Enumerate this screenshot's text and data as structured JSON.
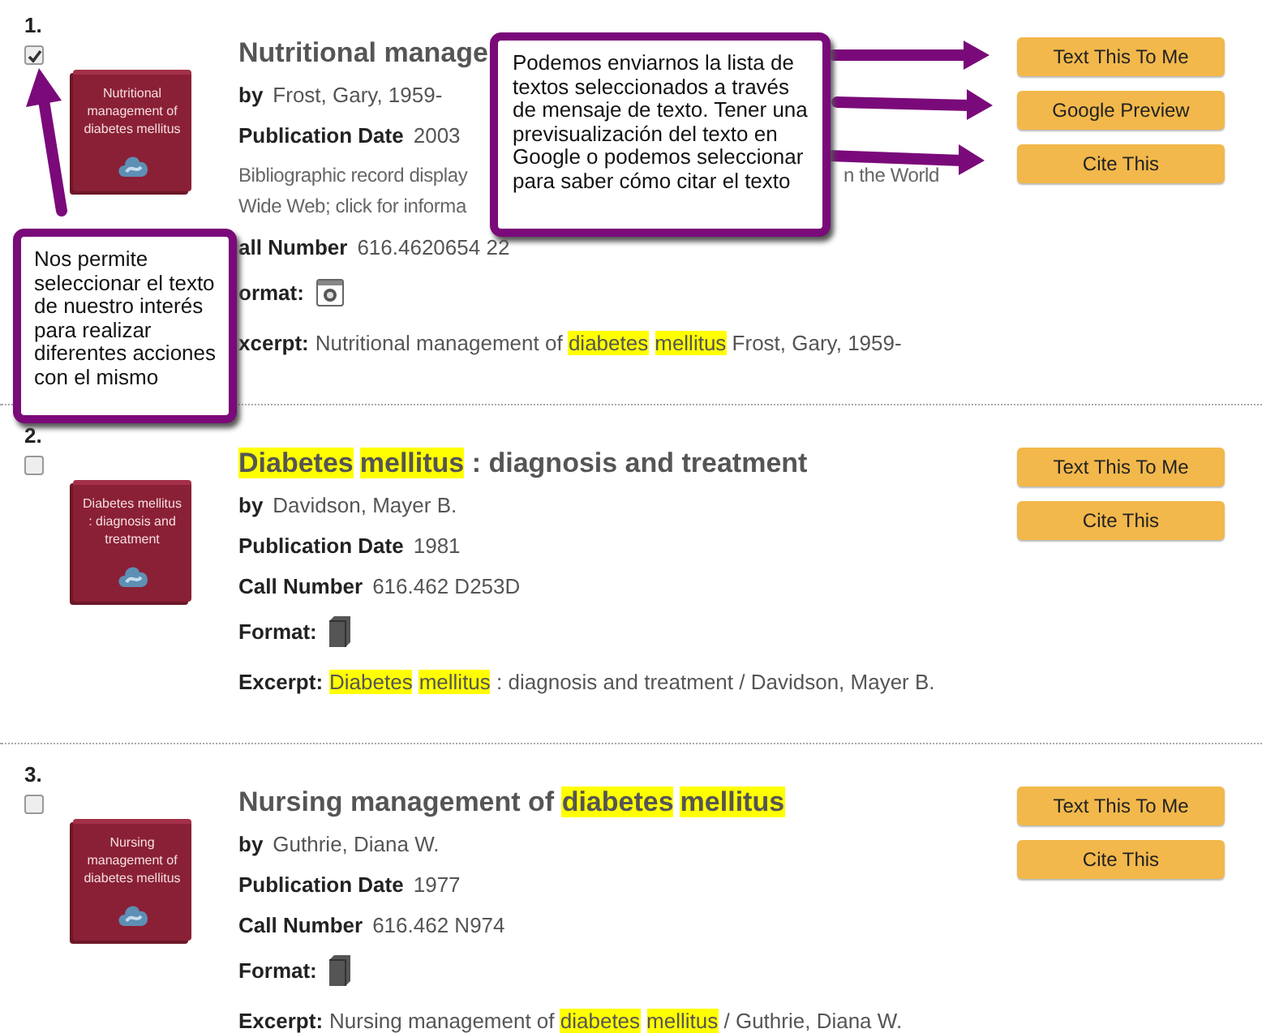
{
  "records": [
    {
      "number": "1.",
      "checked": true,
      "cover_text": "Nutritional management of diabetes mellitus",
      "title": [
        {
          "text": "Nutritional manage",
          "highlight": false
        }
      ],
      "fields": [
        {
          "kind": "by",
          "label": "by",
          "value": "Frost, Gary, 1959-"
        },
        {
          "kind": "pair",
          "label": "Publication Date",
          "value": "2003"
        },
        {
          "kind": "note",
          "lines": [
            [
              "Bibliographic record display",
              "n the World"
            ],
            [
              "Wide Web; click for informa"
            ]
          ]
        },
        {
          "kind": "pair",
          "label": "all Number",
          "value": "616.4620654 22"
        },
        {
          "kind": "webformat",
          "label": "ormat:"
        },
        {
          "kind": "excerpt",
          "label": "xcerpt:",
          "segments": [
            {
              "text": "Nutritional management of ",
              "highlight": false
            },
            {
              "text": "diabetes",
              "highlight": true
            },
            {
              "text": "mellitus",
              "highlight": true
            },
            {
              "text": " Frost, Gary, 1959-",
              "highlight": false
            }
          ]
        }
      ],
      "buttons": [
        "Text This To Me",
        "Google Preview",
        "Cite This"
      ]
    },
    {
      "number": "2.",
      "checked": false,
      "cover_text": "Diabetes mellitus : diagnosis and treatment",
      "title": [
        {
          "text": "Diabetes",
          "highlight": true
        },
        {
          "text": "mellitus",
          "highlight": true
        },
        {
          "text": " : diagnosis and treatment",
          "highlight": false
        }
      ],
      "fields": [
        {
          "kind": "by",
          "label": "by",
          "value": "Davidson, Mayer B."
        },
        {
          "kind": "pair",
          "label": "Publication Date",
          "value": "1981"
        },
        {
          "kind": "pair",
          "label": "Call Number",
          "value": "616.462 D253D"
        },
        {
          "kind": "bookformat",
          "label": "Format:"
        },
        {
          "kind": "excerpt",
          "label": "Excerpt:",
          "segments": [
            {
              "text": "Diabetes",
              "highlight": true
            },
            {
              "text": "mellitus",
              "highlight": true
            },
            {
              "text": " : diagnosis and treatment / Davidson, Mayer B.",
              "highlight": false
            }
          ]
        }
      ],
      "buttons": [
        "Text This To Me",
        "Cite This"
      ]
    },
    {
      "number": "3.",
      "checked": false,
      "cover_text": "Nursing management of diabetes mellitus",
      "title": [
        {
          "text": "Nursing management of ",
          "highlight": false
        },
        {
          "text": "diabetes",
          "highlight": true
        },
        {
          "text": "mellitus",
          "highlight": true
        }
      ],
      "fields": [
        {
          "kind": "by",
          "label": "by",
          "value": "Guthrie, Diana W."
        },
        {
          "kind": "pair",
          "label": "Publication Date",
          "value": "1977"
        },
        {
          "kind": "pair",
          "label": "Call Number",
          "value": "616.462 N974"
        },
        {
          "kind": "bookformat",
          "label": "Format:"
        },
        {
          "kind": "excerpt",
          "label": "Excerpt:",
          "segments": [
            {
              "text": "Nursing management of ",
              "highlight": false
            },
            {
              "text": "diabetes",
              "highlight": true
            },
            {
              "text": "mellitus",
              "highlight": true
            },
            {
              "text": " / Guthrie, Diana W.",
              "highlight": false
            }
          ]
        }
      ],
      "buttons": [
        "Text This To Me",
        "Cite This"
      ]
    }
  ],
  "callouts": [
    {
      "text": "Podemos enviarnos la lista de textos seleccionados a través de mensaje de texto. Tener una previsualización del texto en Google o podemos seleccionar para saber cómo citar el texto"
    },
    {
      "text": "Nos permite seleccionar el texto de nuestro interés para realizar diferentes acciones con el mismo"
    }
  ]
}
